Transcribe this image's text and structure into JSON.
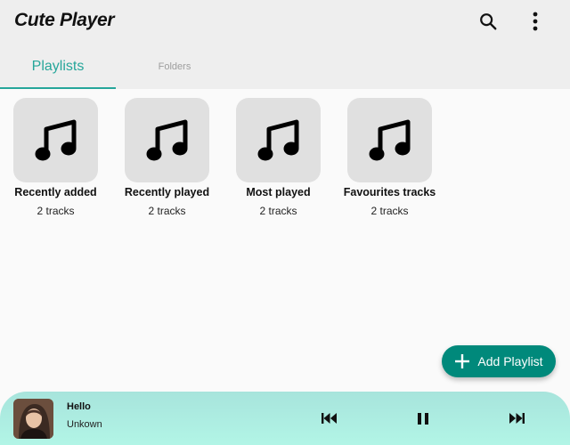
{
  "app": {
    "title": "Cute Player"
  },
  "toolbar": {
    "search_icon": "search-icon",
    "more_icon": "more-vert-icon"
  },
  "tabs": [
    {
      "label": "Playlists",
      "selected": true
    },
    {
      "label": "Folders",
      "selected": false
    }
  ],
  "playlists": [
    {
      "name": "Recently added",
      "count": "2 tracks",
      "icon": "music-note-icon"
    },
    {
      "name": "Recently played",
      "count": "2 tracks",
      "icon": "music-note-icon"
    },
    {
      "name": "Most played",
      "count": "2 tracks",
      "icon": "music-note-icon"
    },
    {
      "name": "Favourites tracks",
      "count": "2 tracks",
      "icon": "music-note-icon"
    }
  ],
  "fab": {
    "label": "Add Playlist",
    "icon": "plus-icon"
  },
  "now_playing": {
    "title": "Hello",
    "artist": "Unkown",
    "controls": [
      "previous-icon",
      "pause-icon",
      "next-icon"
    ]
  },
  "colors": {
    "accent": "#26a69a",
    "fab": "#00897b",
    "appbar": "#eeeeee",
    "player_gradient_start": "#a7e4dc",
    "player_gradient_end": "#b2f5e6"
  }
}
